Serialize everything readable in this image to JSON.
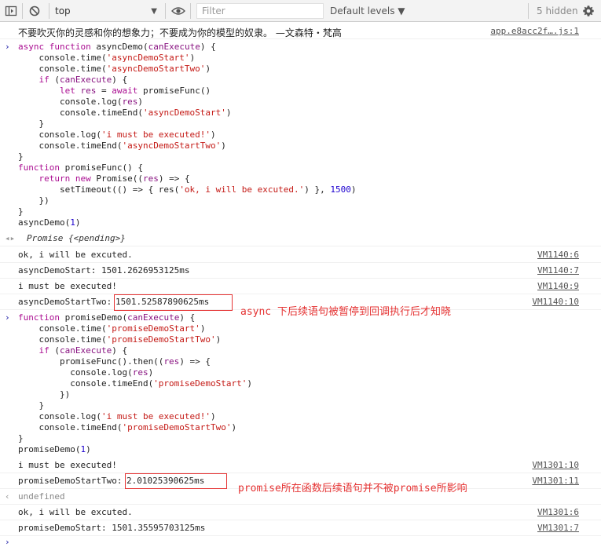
{
  "toolbar": {
    "context": "top",
    "filter_placeholder": "Filter",
    "levels": "Default levels ▼",
    "hidden": "5 hidden"
  },
  "messages": {
    "quote": "不要吹灭你的灵感和你的想象力；不要成为你的模型的奴隶。 —文森特・梵高",
    "quote_src": "app.e8acc2f….js:1",
    "promise_pending": "Promise {<pending>}",
    "log1": "ok, i will be excuted.",
    "log1_src": "VM1140:6",
    "log2": "asyncDemoStart: 1501.2626953125ms",
    "log2_src": "VM1140:7",
    "log3": "i must be executed!",
    "log3_src": "VM1140:9",
    "log4_label": "asyncDemoStartTwo: ",
    "log4_value": "1501.52587890625ms",
    "log4_src": "VM1140:10",
    "log5": "i must be executed!",
    "log5_src": "VM1301:10",
    "log6_label": "promiseDemoStartTwo: ",
    "log6_value": "2.01025390625ms",
    "log6_src": "VM1301:11",
    "undefined": "undefined",
    "log7": "ok, i will be excuted.",
    "log7_src": "VM1301:6",
    "log8": "promiseDemoStart: 1501.35595703125ms",
    "log8_src": "VM1301:7"
  },
  "annotations": {
    "async_note": "async 下后续语句被暂停到回调执行后才知晓",
    "promise_note": "promise所在函数后续语句并不被promise所影响"
  },
  "colors": {
    "annotation": "#e53333",
    "link": "#545454",
    "string": "#c41a16",
    "keyword": "#aa0d91"
  }
}
